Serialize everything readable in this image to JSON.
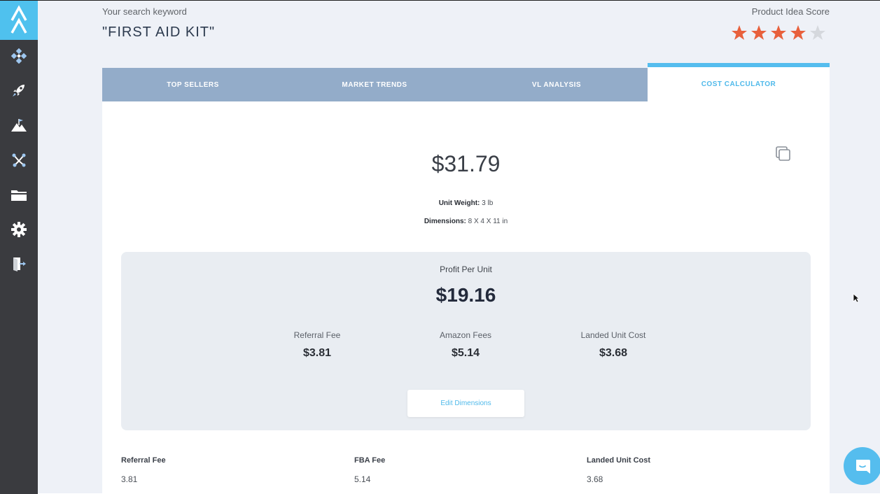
{
  "header": {
    "search_caption": "Your search keyword",
    "keyword": "\"FIRST AID KIT\"",
    "score_caption": "Product Idea Score",
    "score_stars": 4.5,
    "star_color": "#e8603c"
  },
  "sidebar": {
    "items": [
      {
        "icon": "dashboard-icon"
      },
      {
        "icon": "rocket-icon"
      },
      {
        "icon": "mountain-flag-icon"
      },
      {
        "icon": "network-icon"
      },
      {
        "icon": "folder-icon"
      },
      {
        "icon": "gear-icon"
      },
      {
        "icon": "logout-icon"
      }
    ]
  },
  "tabs": [
    {
      "label": "TOP SELLERS"
    },
    {
      "label": "MARKET TRENDS"
    },
    {
      "label": "VL ANALYSIS"
    },
    {
      "label": "COST CALCULATOR"
    }
  ],
  "calculator": {
    "price": "$31.79",
    "unit_weight_label": "Unit Weight:",
    "unit_weight_value": "3 lb",
    "dimensions_label": "Dimensions:",
    "dimensions_value": "8 X 4 X 11 in",
    "profit_caption": "Profit Per Unit",
    "profit_value": "$19.16",
    "fees": [
      {
        "label": "Referral Fee",
        "value": "$3.81"
      },
      {
        "label": "Amazon Fees",
        "value": "$5.14"
      },
      {
        "label": "Landed Unit Cost",
        "value": "$3.68"
      }
    ],
    "edit_button": "Edit Dimensions",
    "bottom": [
      {
        "label": "Referral Fee",
        "value": "3.81"
      },
      {
        "label": "FBA Fee",
        "value": "5.14"
      },
      {
        "label": "Landed Unit Cost",
        "value": "3.68"
      }
    ]
  },
  "colors": {
    "accent": "#4fb9ea",
    "sidebar": "#3a3b3f",
    "tabbar": "#93acc9"
  }
}
